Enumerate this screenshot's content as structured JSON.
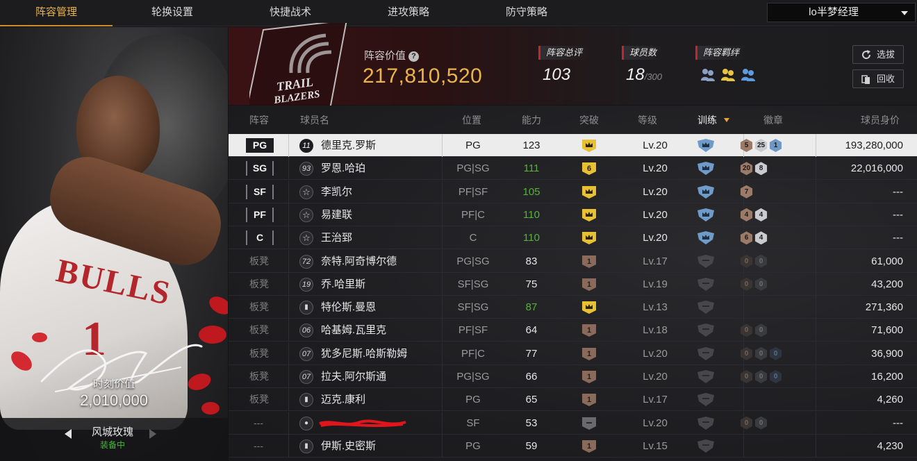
{
  "nav": {
    "tabs": [
      "阵容管理",
      "轮换设置",
      "快捷战术",
      "进攻策略",
      "防守策略"
    ],
    "active_tab": "阵容管理",
    "manager_name": "lo半梦经理"
  },
  "card": {
    "jersey_text": "BULLS",
    "jersey_number": "1",
    "value_label": "时刻价值",
    "value": "2,010,000",
    "skin_name": "风城玫瑰",
    "skin_status": "装备中"
  },
  "team": {
    "logo_text_1": "TRAIL",
    "logo_text_2": "BLAZERS",
    "lineup_value_label": "阵容价值",
    "lineup_value": "217,810,520",
    "overall_label": "阵容总评",
    "overall": "103",
    "players_label": "球员数",
    "players": "18",
    "players_max": "/300",
    "bond_label": "阵容羁绊",
    "select_btn": "选拔",
    "recycle_btn": "回收"
  },
  "table": {
    "headers": [
      "阵容",
      "球员名",
      "位置",
      "能力",
      "突破",
      "等级",
      "训练",
      "徽章",
      "球员身价"
    ],
    "sorted_column": "训练",
    "rows": [
      {
        "slot": "PG",
        "num": "11",
        "icon": "number-icon",
        "name": "德里克.罗斯",
        "pos": "PG",
        "rating": "123",
        "rating_color": "#1c1c1c",
        "grade": "crown-gold",
        "level": "Lv.20",
        "train": "blue",
        "medals": [
          [
            "bronze",
            "5"
          ],
          [
            "silver",
            "25"
          ],
          [
            "blue",
            "1"
          ]
        ],
        "value": "193,280,000"
      },
      {
        "slot": "SG",
        "num": "93",
        "icon": "number-icon",
        "name": "罗恩.哈珀",
        "pos": "PG|SG",
        "rating": "111",
        "rating_color": "#58b03d",
        "grade": "6",
        "level": "Lv.20",
        "train": "blue",
        "medals": [
          [
            "bronze",
            "20"
          ],
          [
            "silver",
            "8"
          ]
        ],
        "value": "22,016,000"
      },
      {
        "slot": "SF",
        "num": "",
        "icon": "star-icon",
        "name": "李凯尔",
        "pos": "PF|SF",
        "rating": "105",
        "rating_color": "#58b03d",
        "grade": "crown-gold",
        "level": "Lv.20",
        "train": "blue",
        "medals": [
          [
            "bronze",
            "7"
          ]
        ],
        "value": "---"
      },
      {
        "slot": "PF",
        "num": "",
        "icon": "star-icon",
        "name": "易建联",
        "pos": "PF|C",
        "rating": "110",
        "rating_color": "#58b03d",
        "grade": "crown-gold",
        "level": "Lv.20",
        "train": "blue",
        "medals": [
          [
            "bronze",
            "4"
          ],
          [
            "silver",
            "4"
          ]
        ],
        "value": "---"
      },
      {
        "slot": "C",
        "num": "",
        "icon": "star-icon",
        "name": "王治郅",
        "pos": "C",
        "rating": "110",
        "rating_color": "#58b03d",
        "grade": "crown-gold",
        "level": "Lv.20",
        "train": "blue",
        "medals": [
          [
            "bronze",
            "6"
          ],
          [
            "silver",
            "4"
          ]
        ],
        "value": "---"
      },
      {
        "slot": "板凳",
        "num": "72",
        "icon": "number-icon",
        "name": "奈特.阿奇博尔德",
        "pos": "PG|SG",
        "rating": "83",
        "rating_color": "#e6e6e6",
        "grade": "1",
        "level": "Lv.17",
        "train": "gray",
        "medals": [
          [
            "empty-b",
            "0"
          ],
          [
            "empty-s",
            "0"
          ]
        ],
        "value": "61,000"
      },
      {
        "slot": "板凳",
        "num": "19",
        "icon": "number-icon",
        "name": "乔.哈里斯",
        "pos": "SF|SG",
        "rating": "75",
        "rating_color": "#e6e6e6",
        "grade": "1",
        "level": "Lv.19",
        "train": "gray",
        "medals": [
          [
            "empty-b",
            "0"
          ],
          [
            "empty-s",
            "0"
          ]
        ],
        "value": "43,200"
      },
      {
        "slot": "板凳",
        "num": "",
        "icon": "bars-icon",
        "name": "特伦斯.曼恩",
        "pos": "SF|SG",
        "rating": "87",
        "rating_color": "#58b03d",
        "grade": "crown-gold",
        "level": "Lv.13",
        "train": "gray",
        "medals": [],
        "value": "271,360"
      },
      {
        "slot": "板凳",
        "num": "06",
        "icon": "number-icon",
        "name": "哈基姆.瓦里克",
        "pos": "PF|SF",
        "rating": "64",
        "rating_color": "#e6e6e6",
        "grade": "1",
        "level": "Lv.18",
        "train": "gray",
        "medals": [
          [
            "empty-b",
            "0"
          ],
          [
            "empty-s",
            "0"
          ]
        ],
        "value": "71,600"
      },
      {
        "slot": "板凳",
        "num": "07",
        "icon": "number-icon",
        "name": "犹多尼斯.哈斯勒姆",
        "pos": "PF|C",
        "rating": "77",
        "rating_color": "#e6e6e6",
        "grade": "1",
        "level": "Lv.20",
        "train": "gray",
        "medals": [
          [
            "empty-b",
            "0"
          ],
          [
            "empty-s",
            "0"
          ],
          [
            "empty-bl",
            "0"
          ]
        ],
        "value": "36,900"
      },
      {
        "slot": "板凳",
        "num": "07",
        "icon": "number-icon",
        "name": "拉夫.阿尔斯通",
        "pos": "PG|SG",
        "rating": "66",
        "rating_color": "#e6e6e6",
        "grade": "1",
        "level": "Lv.20",
        "train": "gray",
        "medals": [
          [
            "empty-b",
            "0"
          ],
          [
            "empty-s",
            "0"
          ],
          [
            "empty-bl",
            "0"
          ]
        ],
        "value": "16,200"
      },
      {
        "slot": "板凳",
        "num": "",
        "icon": "bars-icon",
        "name": "迈克.康利",
        "pos": "PG",
        "rating": "65",
        "rating_color": "#e6e6e6",
        "grade": "1",
        "level": "Lv.17",
        "train": "gray",
        "medals": [],
        "value": "4,260"
      },
      {
        "slot": "---",
        "num": "",
        "icon": "person-icon",
        "name": "",
        "censored": true,
        "pos": "SF",
        "rating": "53",
        "rating_color": "#e6e6e6",
        "grade": "dash",
        "level": "Lv.20",
        "train": "gray",
        "medals": [
          [
            "empty-b",
            "0"
          ],
          [
            "empty-s",
            "0"
          ]
        ],
        "value": "---"
      },
      {
        "slot": "---",
        "num": "",
        "icon": "bars-icon",
        "name": "伊斯.史密斯",
        "pos": "PG",
        "rating": "59",
        "rating_color": "#e6e6e6",
        "grade": "1",
        "level": "Lv.15",
        "train": "gray",
        "medals": [],
        "value": "4,230"
      }
    ]
  },
  "colors": {
    "accent_gold": "#e9b54a",
    "rating_green": "#58b03d",
    "badge_red": "#c5262d"
  }
}
